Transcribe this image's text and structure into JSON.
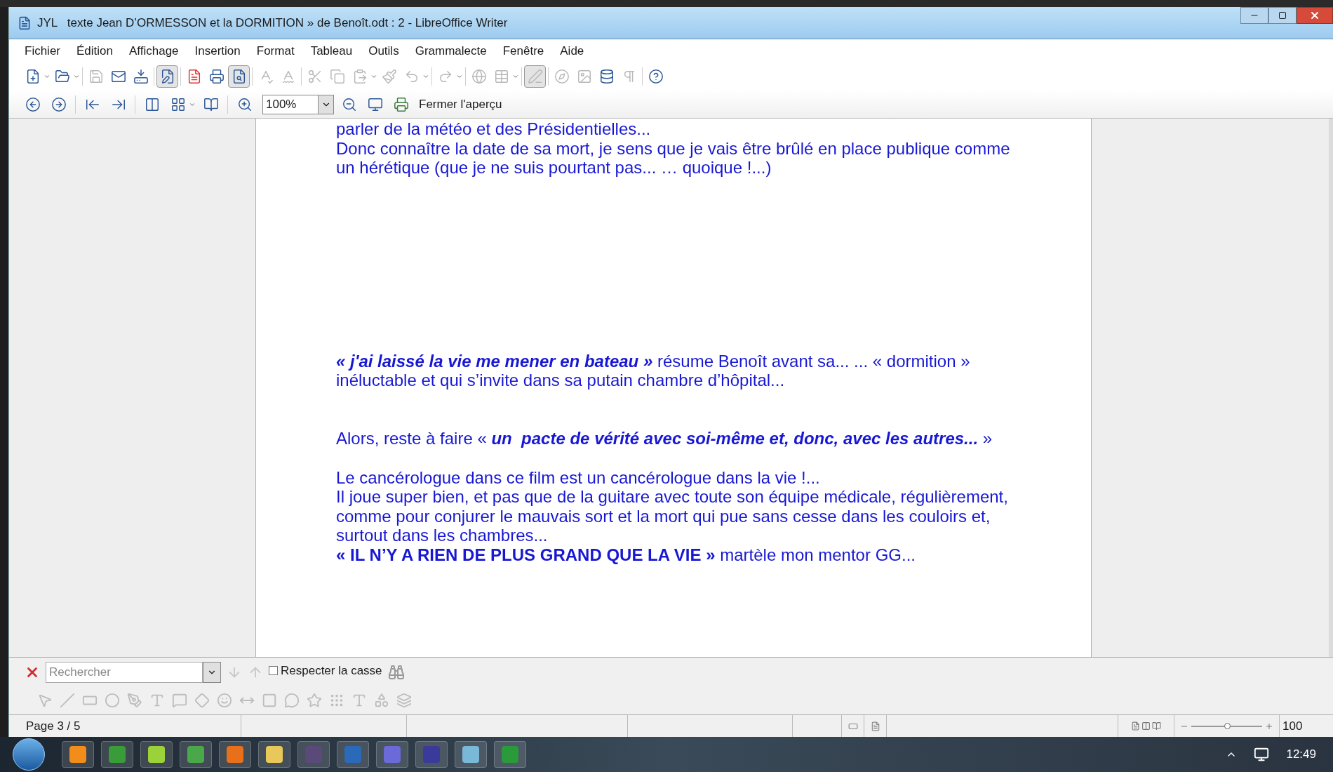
{
  "window": {
    "title": "JYL   texte Jean D’ORMESSON et la DORMITION » de Benoît.odt : 2 - LibreOffice Writer"
  },
  "menu": [
    "Fichier",
    "Édition",
    "Affichage",
    "Insertion",
    "Format",
    "Tableau",
    "Outils",
    "Grammalecte",
    "Fenêtre",
    "Aide"
  ],
  "toolbar_standard": [
    {
      "disabled": false,
      "pressed": false
    },
    {
      "disabled": false,
      "pressed": false
    },
    {
      "disabled": true,
      "pressed": false
    },
    {
      "disabled": false,
      "pressed": false
    },
    {
      "disabled": false,
      "pressed": false
    },
    {
      "disabled": false,
      "pressed": true
    },
    {
      "disabled": false,
      "pressed": false
    },
    {
      "disabled": false,
      "pressed": false
    },
    {
      "disabled": false,
      "pressed": true
    },
    {
      "disabled": true,
      "pressed": false
    },
    {
      "disabled": true,
      "pressed": false
    },
    {
      "disabled": true,
      "pressed": false
    },
    {
      "disabled": true,
      "pressed": false
    },
    {
      "disabled": true,
      "pressed": false
    },
    {
      "disabled": true,
      "pressed": false
    },
    {
      "disabled": true,
      "pressed": false
    },
    {
      "disabled": true,
      "pressed": false
    },
    {
      "disabled": true,
      "pressed": false
    },
    {
      "disabled": true,
      "pressed": false
    },
    {
      "disabled": true,
      "pressed": true
    },
    {
      "disabled": true,
      "pressed": false
    },
    {
      "disabled": true,
      "pressed": false
    },
    {
      "disabled": false,
      "pressed": false
    },
    {
      "disabled": true,
      "pressed": false
    },
    {
      "disabled": false,
      "pressed": false
    }
  ],
  "preview_toolbar": {
    "zoom": "100%",
    "close_label": "Fermer l'aperçu"
  },
  "document": {
    "paragraphs": [
      {
        "lines": [
          [
            {
              "text": "parler de la météo et des Présidentielles..."
            }
          ],
          [
            {
              "text": "Donc connaître la date de sa mort, je sens que je vais être brûlé en place publique comme"
            }
          ],
          [
            {
              "text": "un hérétique (que je ne suis pourtant pas... … quoique !...)"
            }
          ]
        ]
      },
      {
        "lines": [
          [
            {
              "text": "« j'ai laissé la vie me mener en bateau »",
              "bold": true,
              "italic": true
            },
            {
              "text": " résume Benoît avant sa... ... « dormition »"
            }
          ],
          [
            {
              "text": "inéluctable et qui s’invite dans sa putain chambre d’hôpital..."
            }
          ]
        ]
      },
      {
        "lines": [
          [
            {
              "text": "Alors, reste à faire « "
            },
            {
              "text": "un  pacte de vérité avec soi-même et, donc, avec les autres...",
              "bold": true,
              "italic": true
            },
            {
              "text": " »"
            }
          ]
        ]
      },
      {
        "lines": [
          [
            {
              "text": "Le cancérologue dans ce film est un cancérologue dans la vie !..."
            }
          ],
          [
            {
              "text": "Il joue super bien, et pas que de la guitare avec toute son équipe médicale, régulièrement,"
            }
          ],
          [
            {
              "text": "comme pour conjurer le mauvais sort et la mort qui pue sans cesse dans les couloirs et,"
            }
          ],
          [
            {
              "text": "surtout dans les chambres..."
            }
          ],
          [
            {
              "text": "« IL N’Y A RIEN DE PLUS GRAND QUE LA VIE »",
              "bold": true
            },
            {
              "text": " martèle mon mentor GG..."
            }
          ]
        ]
      }
    ]
  },
  "find_bar": {
    "placeholder": "Rechercher",
    "match_case": {
      "label": "Respecter la casse",
      "checked": false
    }
  },
  "status_bar": {
    "page": "Page 3 / 5",
    "zoom": {
      "level": 0.5,
      "reading": "100"
    }
  },
  "taskbar": {
    "clock": "12:49"
  }
}
